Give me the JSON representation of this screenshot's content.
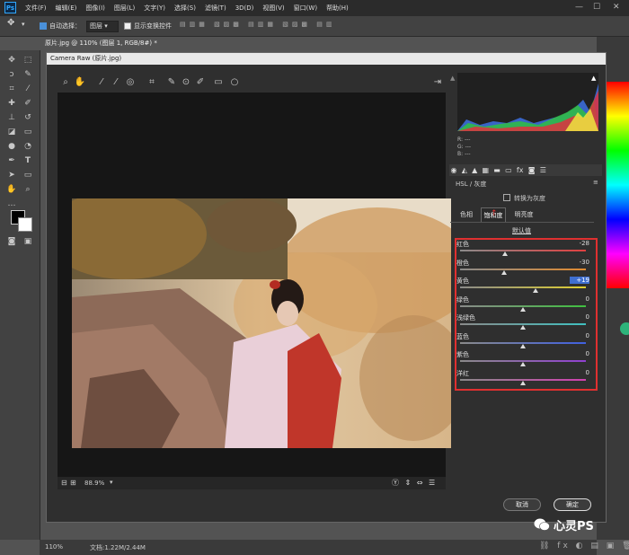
{
  "app": {
    "logo_text": "Ps",
    "menu": [
      "文件(F)",
      "编辑(E)",
      "图像(I)",
      "图层(L)",
      "文字(Y)",
      "选择(S)",
      "滤镜(T)",
      "3D(D)",
      "视图(V)",
      "窗口(W)",
      "帮助(H)"
    ]
  },
  "options_bar": {
    "auto_select_label": "自动选择：",
    "auto_select_value": "图层",
    "show_transform_label": "显示变换控件"
  },
  "document_tab": "原片.jpg @ 110% (图层 1, RGB/8#) *",
  "status_bar": {
    "zoom": "110%",
    "doc_size": "文档:1.22M/2.44M"
  },
  "camera_raw": {
    "title": "Camera Raw (原片.jpg)",
    "zoom_value": "88.9%",
    "rgb_readout": {
      "r": "R:",
      "g": "G:",
      "b": "B:",
      "r_val": "---",
      "g_val": "---",
      "b_val": "---"
    },
    "panel_title": "HSL / 灰度",
    "convert_grayscale_label": "转换为灰度",
    "subtabs": [
      "色相",
      "饱和度",
      "明亮度"
    ],
    "active_subtab": 1,
    "default_link": "默认值",
    "sliders": [
      {
        "label": "红色",
        "value": "-28",
        "fraction": 0.36,
        "color": "#e04040"
      },
      {
        "label": "橙色",
        "value": "-30",
        "fraction": 0.35,
        "color": "#e08a30"
      },
      {
        "label": "黄色",
        "value": "+19",
        "fraction": 0.6,
        "color": "#e0d030",
        "highlight": true
      },
      {
        "label": "绿色",
        "value": "0",
        "fraction": 0.5,
        "color": "#40c040"
      },
      {
        "label": "浅绿色",
        "value": "0",
        "fraction": 0.5,
        "color": "#40c0c0"
      },
      {
        "label": "蓝色",
        "value": "0",
        "fraction": 0.5,
        "color": "#4060e0"
      },
      {
        "label": "紫色",
        "value": "0",
        "fraction": 0.5,
        "color": "#9040d0"
      },
      {
        "label": "洋红",
        "value": "0",
        "fraction": 0.5,
        "color": "#d040b0"
      }
    ],
    "cancel_label": "取消",
    "ok_label": "确定"
  },
  "watermark": "心灵PS",
  "colors": {
    "accent": "#31a8ff",
    "highlight_box": "#e03030"
  }
}
